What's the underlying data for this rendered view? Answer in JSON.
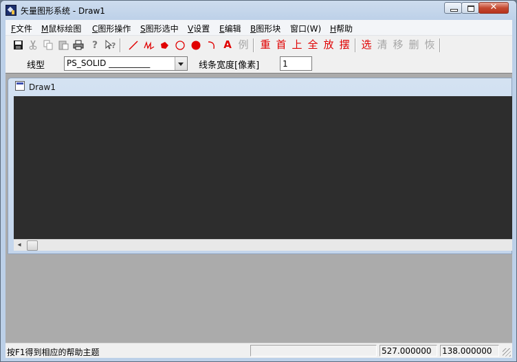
{
  "window": {
    "title": "矢量图形系统 - Draw1",
    "close_glyph": "✕"
  },
  "menu": [
    {
      "mnemonic": "F",
      "label": "文件"
    },
    {
      "mnemonic": "M",
      "label": "鼠标绘图"
    },
    {
      "mnemonic": "C",
      "label": "图形操作"
    },
    {
      "mnemonic": "S",
      "label": "图形选中"
    },
    {
      "mnemonic": "V",
      "label": "设置"
    },
    {
      "mnemonic": "E",
      "label": "编辑"
    },
    {
      "mnemonic": "B",
      "label": "图形块"
    },
    {
      "mnemonic": "",
      "label": "窗口(W)"
    },
    {
      "mnemonic": "H",
      "label": "帮助"
    }
  ],
  "toolbar": {
    "text_tool": "A",
    "example": "例",
    "chars_group1": [
      "重",
      "首",
      "上",
      "全",
      "放",
      "摆"
    ],
    "chars_group2": [
      "选",
      "清",
      "移",
      "删",
      "恢"
    ],
    "icons": [
      "save-icon",
      "cut-icon",
      "copy-icon",
      "paste-icon",
      "print-icon",
      "help-icon",
      "context-help-icon",
      "line-icon",
      "polyline-icon",
      "filled-polygon-icon",
      "circle-icon",
      "filled-circle-icon",
      "arc-icon"
    ]
  },
  "options": {
    "line_type_label": "线型",
    "line_type_value": "PS_SOLID",
    "line_width_label": "线条宽度[像素]",
    "line_width_value": "1"
  },
  "document": {
    "title": "Draw1"
  },
  "status": {
    "help_text": "按F1得到相应的帮助主题",
    "x": "527.000000",
    "y": "138.000000"
  },
  "colors": {
    "canvas": "#2d2d2d",
    "mdi_bg": "#ababab",
    "accent_red": "#e00000"
  }
}
